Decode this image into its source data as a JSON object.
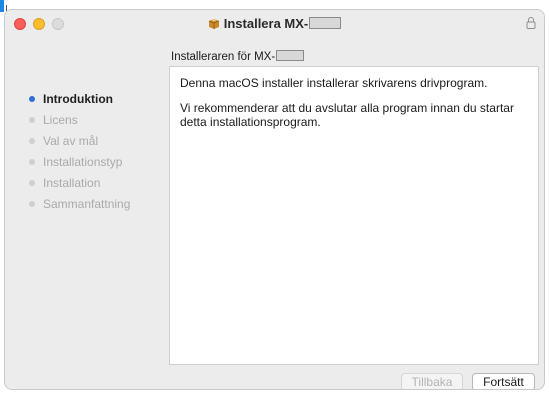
{
  "window": {
    "title_prefix": "Installera MX-",
    "subtitle_prefix": "Installeraren för MX-"
  },
  "steps": [
    {
      "label": "Introduktion",
      "active": true
    },
    {
      "label": "Licens",
      "active": false
    },
    {
      "label": "Val av mål",
      "active": false
    },
    {
      "label": "Installationstyp",
      "active": false
    },
    {
      "label": "Installation",
      "active": false
    },
    {
      "label": "Sammanfattning",
      "active": false
    }
  ],
  "content": {
    "paragraph1": "Denna macOS installer installerar skrivarens drivprogram.",
    "paragraph2": "Vi rekommenderar att du avslutar alla program innan du startar detta installationsprogram."
  },
  "buttons": {
    "back": "Tillbaka",
    "continue": "Fortsätt"
  },
  "icons": {
    "package": "package-icon",
    "lock": "lock-icon"
  },
  "colors": {
    "active_step": "#2c6fd6",
    "close": "#fe5f57",
    "minimize": "#febc2e"
  }
}
